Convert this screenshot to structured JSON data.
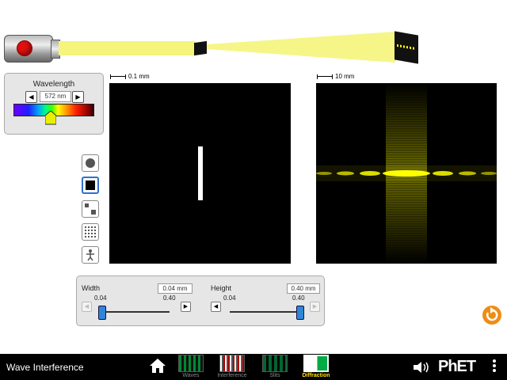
{
  "wavelength": {
    "title": "Wavelength",
    "value": "572 nm",
    "decrement": "◀",
    "increment": "▶"
  },
  "scales": {
    "aperture": "0.1 mm",
    "pattern": "10 mm"
  },
  "aperture_shapes": [
    {
      "name": "circle",
      "selected": false
    },
    {
      "name": "rectangle",
      "selected": true
    },
    {
      "name": "two-squares",
      "selected": false
    },
    {
      "name": "grid",
      "selected": false
    },
    {
      "name": "wave-packet",
      "selected": false
    }
  ],
  "controls": {
    "width": {
      "label": "Width",
      "value": "0.04 mm",
      "min": "0.04",
      "max": "0.40",
      "level": 0
    },
    "height": {
      "label": "Height",
      "value": "0.40 mm",
      "min": "0.04",
      "max": "0.40",
      "level": 1
    }
  },
  "navbar": {
    "title": "Wave Interference",
    "screens": [
      {
        "label": "Waves",
        "active": false
      },
      {
        "label": "Interference",
        "active": false
      },
      {
        "label": "Slits",
        "active": false
      },
      {
        "label": "Diffraction",
        "active": true
      }
    ],
    "logo": "PhET"
  },
  "colors": {
    "beam": "#f4f57a",
    "pattern": "#ffff00",
    "accent": "#2f6fcf",
    "reset": "#f08c14"
  }
}
